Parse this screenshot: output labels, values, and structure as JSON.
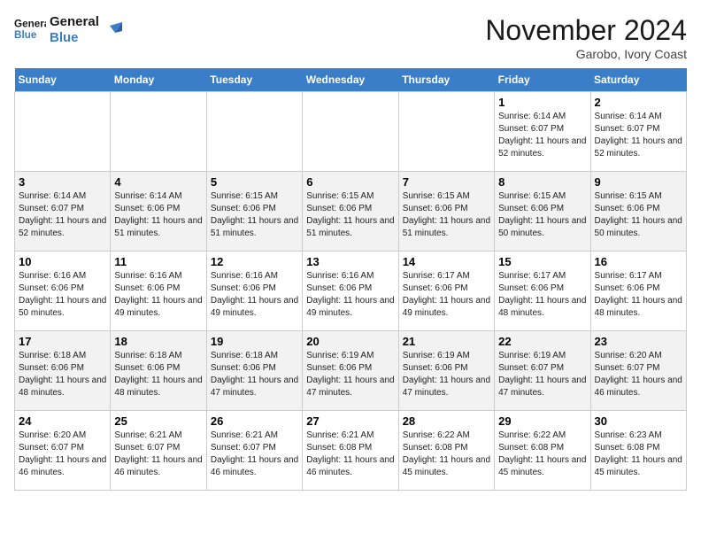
{
  "header": {
    "logo_line1": "General",
    "logo_line2": "Blue",
    "month_title": "November 2024",
    "location": "Garobo, Ivory Coast"
  },
  "weekdays": [
    "Sunday",
    "Monday",
    "Tuesday",
    "Wednesday",
    "Thursday",
    "Friday",
    "Saturday"
  ],
  "weeks": [
    [
      {
        "day": "",
        "info": ""
      },
      {
        "day": "",
        "info": ""
      },
      {
        "day": "",
        "info": ""
      },
      {
        "day": "",
        "info": ""
      },
      {
        "day": "",
        "info": ""
      },
      {
        "day": "1",
        "info": "Sunrise: 6:14 AM\nSunset: 6:07 PM\nDaylight: 11 hours and 52 minutes."
      },
      {
        "day": "2",
        "info": "Sunrise: 6:14 AM\nSunset: 6:07 PM\nDaylight: 11 hours and 52 minutes."
      }
    ],
    [
      {
        "day": "3",
        "info": "Sunrise: 6:14 AM\nSunset: 6:07 PM\nDaylight: 11 hours and 52 minutes."
      },
      {
        "day": "4",
        "info": "Sunrise: 6:14 AM\nSunset: 6:06 PM\nDaylight: 11 hours and 51 minutes."
      },
      {
        "day": "5",
        "info": "Sunrise: 6:15 AM\nSunset: 6:06 PM\nDaylight: 11 hours and 51 minutes."
      },
      {
        "day": "6",
        "info": "Sunrise: 6:15 AM\nSunset: 6:06 PM\nDaylight: 11 hours and 51 minutes."
      },
      {
        "day": "7",
        "info": "Sunrise: 6:15 AM\nSunset: 6:06 PM\nDaylight: 11 hours and 51 minutes."
      },
      {
        "day": "8",
        "info": "Sunrise: 6:15 AM\nSunset: 6:06 PM\nDaylight: 11 hours and 50 minutes."
      },
      {
        "day": "9",
        "info": "Sunrise: 6:15 AM\nSunset: 6:06 PM\nDaylight: 11 hours and 50 minutes."
      }
    ],
    [
      {
        "day": "10",
        "info": "Sunrise: 6:16 AM\nSunset: 6:06 PM\nDaylight: 11 hours and 50 minutes."
      },
      {
        "day": "11",
        "info": "Sunrise: 6:16 AM\nSunset: 6:06 PM\nDaylight: 11 hours and 49 minutes."
      },
      {
        "day": "12",
        "info": "Sunrise: 6:16 AM\nSunset: 6:06 PM\nDaylight: 11 hours and 49 minutes."
      },
      {
        "day": "13",
        "info": "Sunrise: 6:16 AM\nSunset: 6:06 PM\nDaylight: 11 hours and 49 minutes."
      },
      {
        "day": "14",
        "info": "Sunrise: 6:17 AM\nSunset: 6:06 PM\nDaylight: 11 hours and 49 minutes."
      },
      {
        "day": "15",
        "info": "Sunrise: 6:17 AM\nSunset: 6:06 PM\nDaylight: 11 hours and 48 minutes."
      },
      {
        "day": "16",
        "info": "Sunrise: 6:17 AM\nSunset: 6:06 PM\nDaylight: 11 hours and 48 minutes."
      }
    ],
    [
      {
        "day": "17",
        "info": "Sunrise: 6:18 AM\nSunset: 6:06 PM\nDaylight: 11 hours and 48 minutes."
      },
      {
        "day": "18",
        "info": "Sunrise: 6:18 AM\nSunset: 6:06 PM\nDaylight: 11 hours and 48 minutes."
      },
      {
        "day": "19",
        "info": "Sunrise: 6:18 AM\nSunset: 6:06 PM\nDaylight: 11 hours and 47 minutes."
      },
      {
        "day": "20",
        "info": "Sunrise: 6:19 AM\nSunset: 6:06 PM\nDaylight: 11 hours and 47 minutes."
      },
      {
        "day": "21",
        "info": "Sunrise: 6:19 AM\nSunset: 6:06 PM\nDaylight: 11 hours and 47 minutes."
      },
      {
        "day": "22",
        "info": "Sunrise: 6:19 AM\nSunset: 6:07 PM\nDaylight: 11 hours and 47 minutes."
      },
      {
        "day": "23",
        "info": "Sunrise: 6:20 AM\nSunset: 6:07 PM\nDaylight: 11 hours and 46 minutes."
      }
    ],
    [
      {
        "day": "24",
        "info": "Sunrise: 6:20 AM\nSunset: 6:07 PM\nDaylight: 11 hours and 46 minutes."
      },
      {
        "day": "25",
        "info": "Sunrise: 6:21 AM\nSunset: 6:07 PM\nDaylight: 11 hours and 46 minutes."
      },
      {
        "day": "26",
        "info": "Sunrise: 6:21 AM\nSunset: 6:07 PM\nDaylight: 11 hours and 46 minutes."
      },
      {
        "day": "27",
        "info": "Sunrise: 6:21 AM\nSunset: 6:08 PM\nDaylight: 11 hours and 46 minutes."
      },
      {
        "day": "28",
        "info": "Sunrise: 6:22 AM\nSunset: 6:08 PM\nDaylight: 11 hours and 45 minutes."
      },
      {
        "day": "29",
        "info": "Sunrise: 6:22 AM\nSunset: 6:08 PM\nDaylight: 11 hours and 45 minutes."
      },
      {
        "day": "30",
        "info": "Sunrise: 6:23 AM\nSunset: 6:08 PM\nDaylight: 11 hours and 45 minutes."
      }
    ]
  ]
}
